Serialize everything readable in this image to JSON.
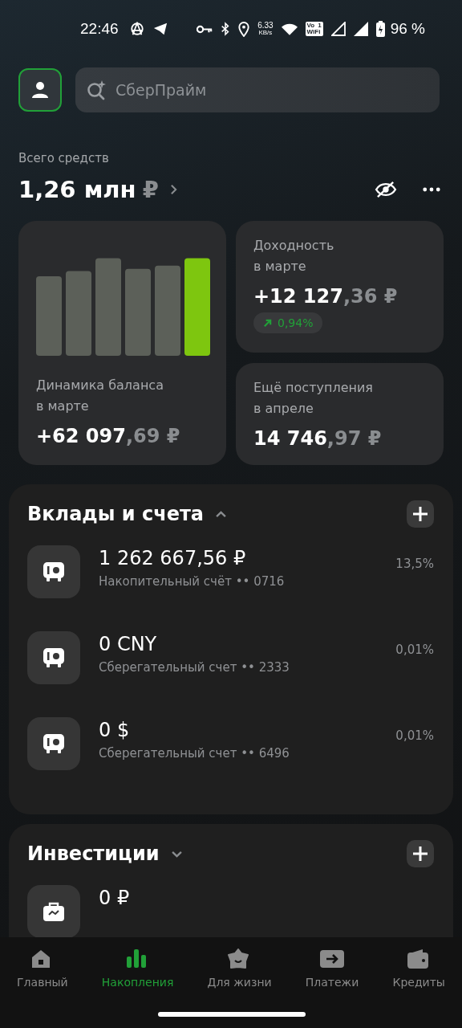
{
  "status_bar": {
    "time": "22:46",
    "net_speed": "6.33",
    "net_unit": "KB/s",
    "vowifi_top": "Vo",
    "vowifi_sim": "1",
    "vowifi_bottom": "WiFi",
    "battery": "96 %"
  },
  "search": {
    "placeholder": "СберПрайм"
  },
  "total": {
    "label": "Всего средств",
    "amount": "1,26 млн",
    "currency": "₽"
  },
  "cards": [
    {
      "kind": "chart",
      "title": "Динамика баланса\nв марте",
      "amount_main": "+62 097",
      "amount_fraction": ",69 ₽"
    },
    {
      "kind": "yield",
      "title": "Доходность\nв марте",
      "amount_main": "+12 127",
      "amount_fraction": ",36 ₽",
      "change": "0,94%"
    },
    {
      "kind": "plain",
      "title": "Ещё поступления\nв апреле",
      "amount_main": "14 746",
      "amount_fraction": ",97 ₽"
    }
  ],
  "sections": [
    {
      "title": "Вклады и счета",
      "expanded": true,
      "accounts": [
        {
          "kind": "safe",
          "amount": "1 262 667,56 ₽",
          "subtitle": "Накопительный счёт •• 0716",
          "rate": "13,5%"
        },
        {
          "kind": "safe",
          "amount": "0 CNY",
          "subtitle": "Сберегательный счет •• 2333",
          "rate": "0,01%"
        },
        {
          "kind": "safe",
          "amount": "0 $",
          "subtitle": "Сберегательный счет •• 6496",
          "rate": "0,01%"
        }
      ]
    },
    {
      "title": "Инвестиции",
      "expanded": false,
      "accounts": [
        {
          "kind": "briefcase",
          "amount": "0 ₽"
        }
      ]
    }
  ],
  "nav": [
    {
      "kind": "home",
      "label": "Главный",
      "selected": false
    },
    {
      "kind": "bars",
      "label": "Накопления",
      "selected": true
    },
    {
      "kind": "star",
      "label": "Для жизни",
      "selected": false
    },
    {
      "kind": "payment",
      "label": "Платежи",
      "selected": false
    },
    {
      "kind": "wallet",
      "label": "Кредиты",
      "selected": false
    }
  ]
}
